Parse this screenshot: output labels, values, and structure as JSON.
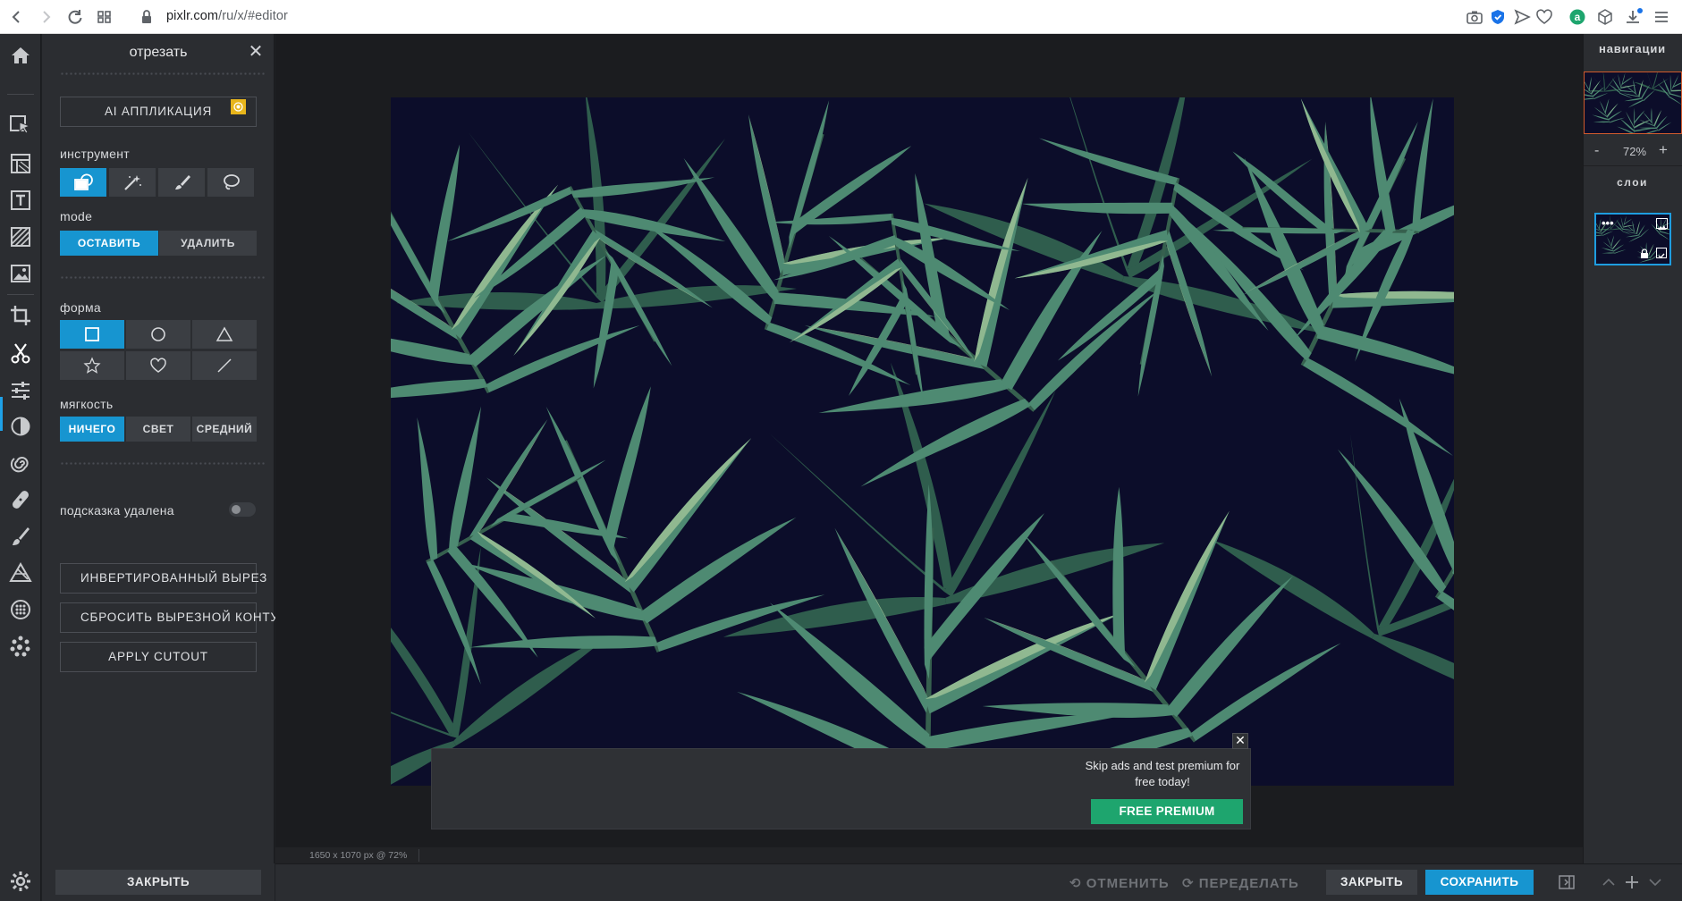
{
  "browser": {
    "url_host": "pixlr.com",
    "url_path": "/ru/x/#editor",
    "colors": {
      "bar": "#ffffff",
      "accent_blue": "#1a73e8"
    }
  },
  "left_toolbar": {
    "active_tool": "cutout-icon",
    "icons": [
      "home-icon",
      "arrange-icon",
      "layout-icon",
      "text-icon",
      "fill-pattern-icon",
      "image-icon",
      "crop-icon",
      "cutout-icon",
      "adjust-icon",
      "filter-icon",
      "liquify-icon",
      "heal-icon",
      "brush-icon",
      "draw-shape-icon",
      "pattern-icon",
      "effects-icon",
      "settings-icon"
    ]
  },
  "panel": {
    "title": "отрезать",
    "ai_button": "AI АППЛИКАЦИЯ",
    "tool_label": "инструмент",
    "tools": [
      "cutout-shape-icon",
      "magic-wand-icon",
      "brush-icon",
      "lasso-icon"
    ],
    "active_tool": 0,
    "mode_label": "mode",
    "mode_options": [
      "ОСТАВИТЬ",
      "УДАЛИТЬ"
    ],
    "active_mode": 0,
    "shape_label": "форма",
    "shapes": [
      "square-icon",
      "circle-icon",
      "triangle-icon",
      "star-icon",
      "heart-icon",
      "line-icon"
    ],
    "active_shape": 0,
    "softness_label": "мягкость",
    "softness_options": [
      "НИЧЕГО",
      "СВЕТ",
      "СРЕДНИЙ"
    ],
    "active_softness": 0,
    "hint_label": "подсказка удалена",
    "hint_enabled": false,
    "invert_button": "ИНВЕРТИРОВАННЫЙ ВЫРЕЗ",
    "reset_button": "СБРОСИТЬ ВЫРЕЗНОЙ КОНТУР",
    "apply_button": "APPLY CUTOUT",
    "close_button": "ЗАКРЫТЬ"
  },
  "canvas": {
    "image_info": "1650 x 1070 px @ 72%",
    "background_color": "#0c0d2a"
  },
  "ad": {
    "text": "Skip ads and test premium for free today!",
    "button": "FREE PREMIUM"
  },
  "navigator": {
    "title": "навигации",
    "zoom_minus": "-",
    "zoom": "72%",
    "zoom_plus": "+"
  },
  "layers": {
    "title": "слои",
    "dots": "•••"
  },
  "bottom": {
    "undo": "ОТМЕНИТЬ",
    "redo": "ПЕРЕДЕЛАТЬ",
    "close": "ЗАКРЫТЬ",
    "save": "СОХРАНИТЬ",
    "colors": {
      "primary": "#1795d0",
      "secondary": "#3b3e43"
    }
  }
}
